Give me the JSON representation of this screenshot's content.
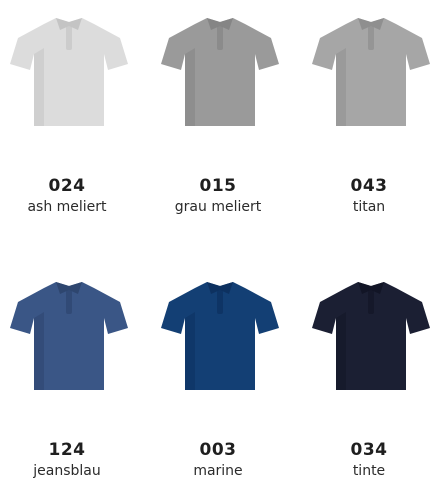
{
  "colors": [
    {
      "code": "024",
      "name": "ash meliert",
      "shirt": "#dcdcdc",
      "shade": "#c4c4c4"
    },
    {
      "code": "015",
      "name": "grau meliert",
      "shirt": "#9a9a9a",
      "shade": "#858585"
    },
    {
      "code": "043",
      "name": "titan",
      "shirt": "#a6a6a6",
      "shade": "#8f8f8f"
    },
    {
      "code": "124",
      "name": "jeansblau",
      "shirt": "#3a5686",
      "shade": "#2e466f"
    },
    {
      "code": "003",
      "name": "marine",
      "shirt": "#133f74",
      "shade": "#0d3160"
    },
    {
      "code": "034",
      "name": "tinte",
      "shirt": "#1b1f33",
      "shade": "#121526"
    }
  ]
}
